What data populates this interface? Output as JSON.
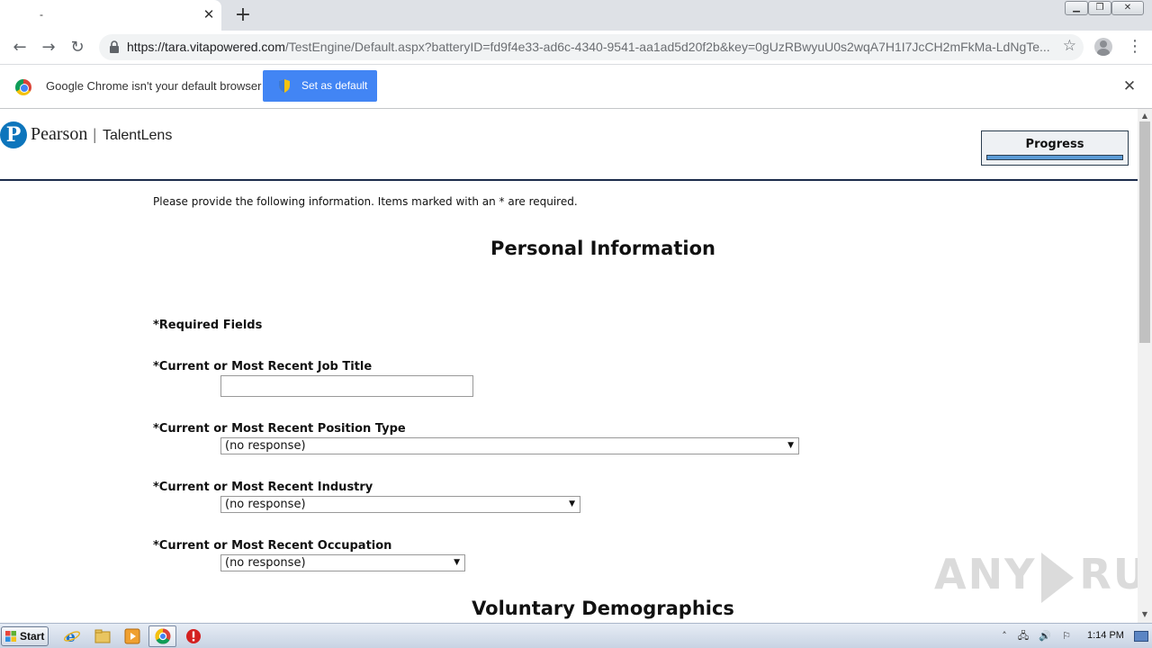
{
  "browser": {
    "tab_title": "-",
    "url_host": "https://tara.vitapowered.com",
    "url_path": "/TestEngine/Default.aspx?batteryID=fd9f4e33-ad6c-4340-9541-aa1ad5d20f2b&key=0gUzRBwyuU0s2wqA7H1I7JcCH2mFkMa-LdNgTe...",
    "infobar_text": "Google Chrome isn't your default browser",
    "set_default_label": "Set as default"
  },
  "page": {
    "brand_name": "Pearson",
    "brand_sub": "TalentLens",
    "progress_label": "Progress",
    "progress_fraction": 1.0,
    "intro": "Please provide the following information. Items marked with an * are required.",
    "heading": "Personal Information",
    "required_note": "*Required Fields",
    "fields": {
      "job_title_label": "*Current or Most Recent Job Title",
      "job_title_value": "",
      "position_type_label": "*Current or Most Recent Position Type",
      "position_type_value": "(no response)",
      "industry_label": "*Current or Most Recent Industry",
      "industry_value": "(no response)",
      "occupation_label": "*Current or Most Recent Occupation",
      "occupation_value": "(no response)"
    },
    "heading2": "Voluntary Demographics"
  },
  "watermark": {
    "left": "ANY",
    "right": "RUN"
  },
  "taskbar": {
    "start_label": "Start",
    "clock": "1:14 PM"
  },
  "colors": {
    "pearson_blue": "#0d75bc",
    "chrome_blue": "#4285f4",
    "header_rule": "#1c2c4c",
    "progress_fill": "#5b9bd5"
  }
}
